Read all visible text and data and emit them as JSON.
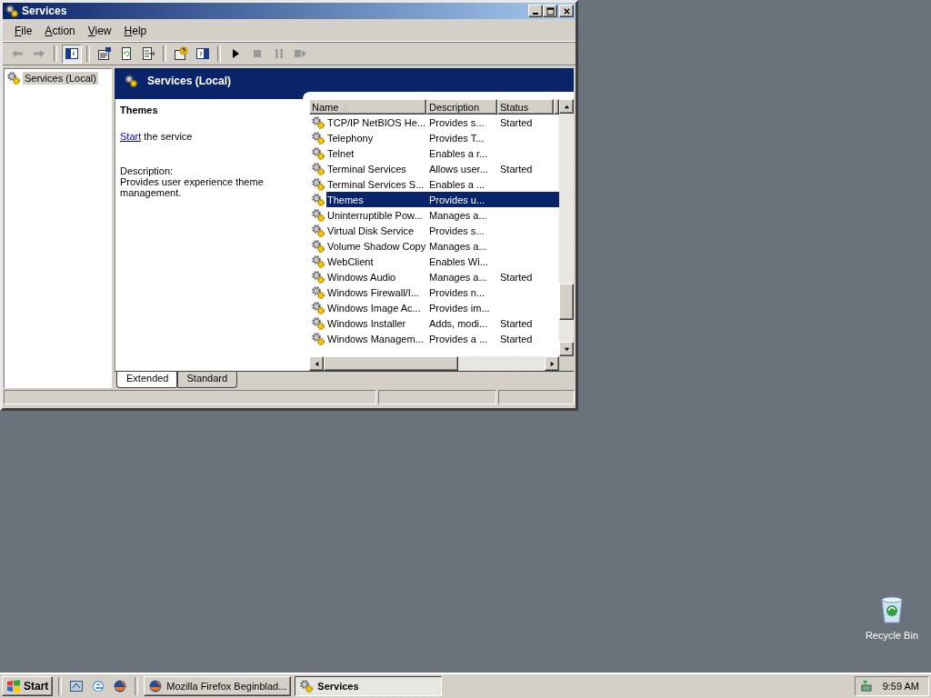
{
  "window": {
    "title": "Services"
  },
  "menu": [
    {
      "label": "File"
    },
    {
      "label": "Action"
    },
    {
      "label": "View"
    },
    {
      "label": "Help"
    }
  ],
  "toolbar": [
    [
      {
        "kind": "back",
        "disabled": true
      },
      {
        "kind": "forward",
        "disabled": true
      }
    ],
    [
      {
        "kind": "tree",
        "pressed": true
      }
    ],
    [
      {
        "kind": "properties",
        "pressed": false
      },
      {
        "kind": "refresh",
        "pressed": false
      },
      {
        "kind": "export",
        "pressed": false
      }
    ],
    [
      {
        "kind": "help",
        "pressed": false
      },
      {
        "kind": "action-pane",
        "pressed": false
      }
    ],
    [
      {
        "kind": "play",
        "disabled": false
      },
      {
        "kind": "stop",
        "disabled": true
      },
      {
        "kind": "pause",
        "disabled": true
      },
      {
        "kind": "restart",
        "disabled": true
      }
    ]
  ],
  "tree": [
    {
      "label": "Services (Local)",
      "selected": true
    }
  ],
  "header": {
    "title": "Services (Local)"
  },
  "detail": {
    "name": "Themes",
    "action_link": "Start",
    "action_text": "the service",
    "description_label": "Description:",
    "description": "Provides user experience theme management."
  },
  "columns": [
    {
      "label": "Name",
      "sorted": true
    },
    {
      "label": "Description",
      "sorted": false
    },
    {
      "label": "Status",
      "sorted": false
    }
  ],
  "rows": [
    {
      "name": "TCP/IP NetBIOS He...",
      "description": "Provides s...",
      "status": "Started",
      "selected": false
    },
    {
      "name": "Telephony",
      "description": "Provides T...",
      "status": "",
      "selected": false
    },
    {
      "name": "Telnet",
      "description": "Enables a r...",
      "status": "",
      "selected": false
    },
    {
      "name": "Terminal Services",
      "description": "Allows user...",
      "status": "Started",
      "selected": false
    },
    {
      "name": "Terminal Services S...",
      "description": "Enables a ...",
      "status": "",
      "selected": false
    },
    {
      "name": "Themes",
      "description": "Provides u...",
      "status": "",
      "selected": true
    },
    {
      "name": "Uninterruptible Pow...",
      "description": "Manages a...",
      "status": "",
      "selected": false
    },
    {
      "name": "Virtual Disk Service",
      "description": "Provides s...",
      "status": "",
      "selected": false
    },
    {
      "name": "Volume Shadow Copy",
      "description": "Manages a...",
      "status": "",
      "selected": false
    },
    {
      "name": "WebClient",
      "description": "Enables Wi...",
      "status": "",
      "selected": false
    },
    {
      "name": "Windows Audio",
      "description": "Manages a...",
      "status": "Started",
      "selected": false
    },
    {
      "name": "Windows Firewall/I...",
      "description": "Provides n...",
      "status": "",
      "selected": false
    },
    {
      "name": "Windows Image Ac...",
      "description": "Provides im...",
      "status": "",
      "selected": false
    },
    {
      "name": "Windows Installer",
      "description": "Adds, modi...",
      "status": "Started",
      "selected": false
    },
    {
      "name": "Windows Managem...",
      "description": "Provides a ...",
      "status": "Started",
      "selected": false
    }
  ],
  "tabs": [
    {
      "label": "Extended",
      "selected": true
    },
    {
      "label": "Standard",
      "selected": false
    }
  ],
  "desktop_icons": [
    {
      "label": "Recycle Bin"
    }
  ],
  "taskbar": {
    "start": "Start",
    "tasks": [
      {
        "label": "Mozilla Firefox Beginblad...",
        "kind": "firefox",
        "selected": false
      },
      {
        "label": "Services",
        "kind": "services",
        "selected": true
      }
    ],
    "clock": "9:59 AM"
  }
}
